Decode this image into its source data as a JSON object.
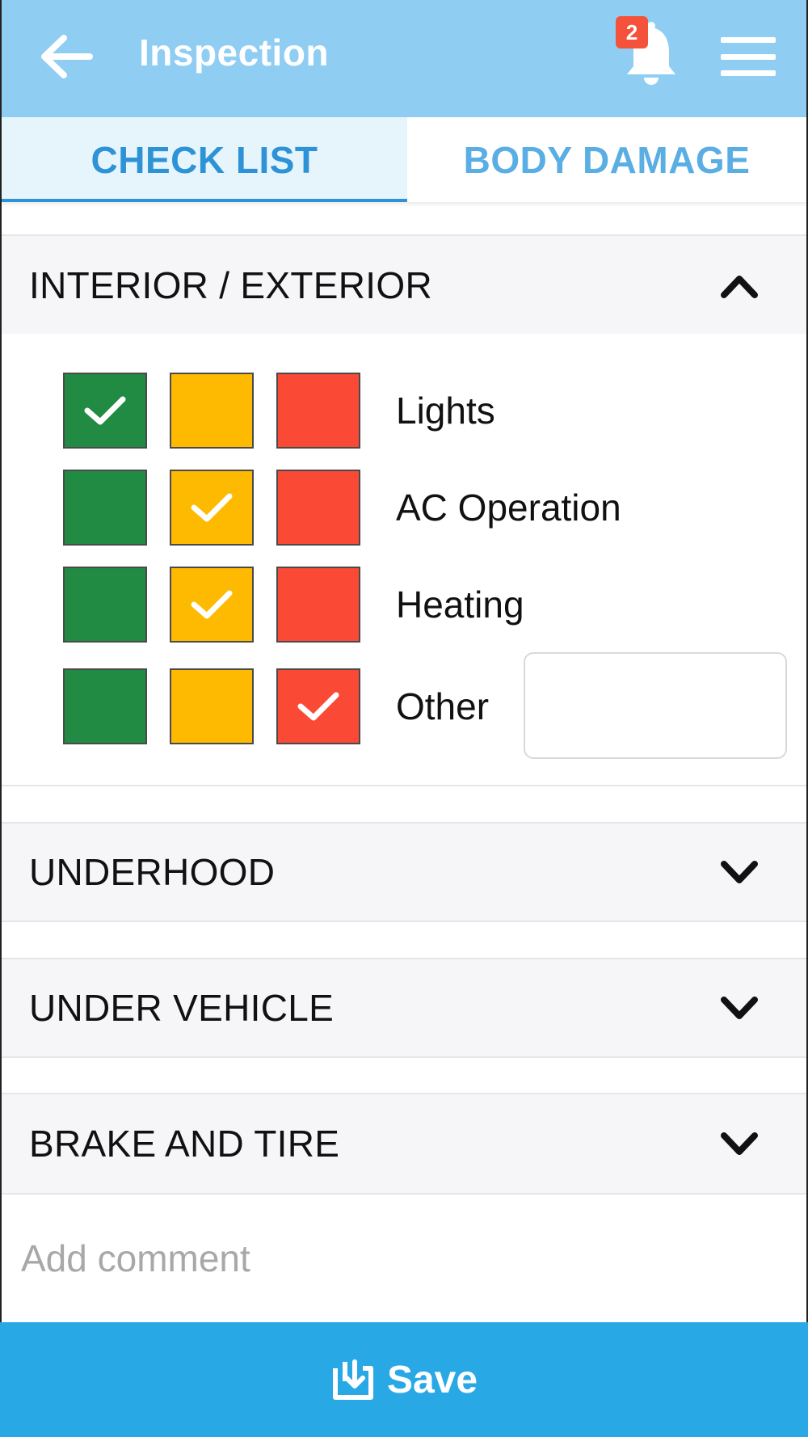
{
  "header": {
    "title": "Inspection",
    "notification_count": "2"
  },
  "tabs": [
    {
      "label": "CHECK LIST",
      "active": true
    },
    {
      "label": "BODY DAMAGE",
      "active": false
    }
  ],
  "sections": [
    {
      "label": "INTERIOR / EXTERIOR",
      "expanded": true,
      "items": [
        {
          "label": "Lights",
          "selected": "green"
        },
        {
          "label": "AC Operation",
          "selected": "yellow"
        },
        {
          "label": "Heating",
          "selected": "yellow"
        },
        {
          "label": "Other",
          "selected": "red",
          "input_value": ""
        }
      ]
    },
    {
      "label": "UNDERHOOD",
      "expanded": false
    },
    {
      "label": "UNDER VEHICLE",
      "expanded": false
    },
    {
      "label": "BRAKE AND TIRE",
      "expanded": false
    }
  ],
  "comment": {
    "placeholder": "Add comment"
  },
  "footer": {
    "save_label": "Save"
  },
  "colors": {
    "header_bg": "#8fcdf3",
    "tab_active": "#2d92d6",
    "status_green": "#228b43",
    "status_yellow": "#fdba01",
    "status_red": "#fa4a36",
    "save_bg": "#29a8e6"
  },
  "icons": {
    "back": "arrow-left-icon",
    "notifications": "bell-icon",
    "menu": "hamburger-menu-icon",
    "collapse": "chevron-up-icon",
    "expand": "chevron-down-icon",
    "check": "checkmark-icon",
    "save": "save-download-icon"
  }
}
